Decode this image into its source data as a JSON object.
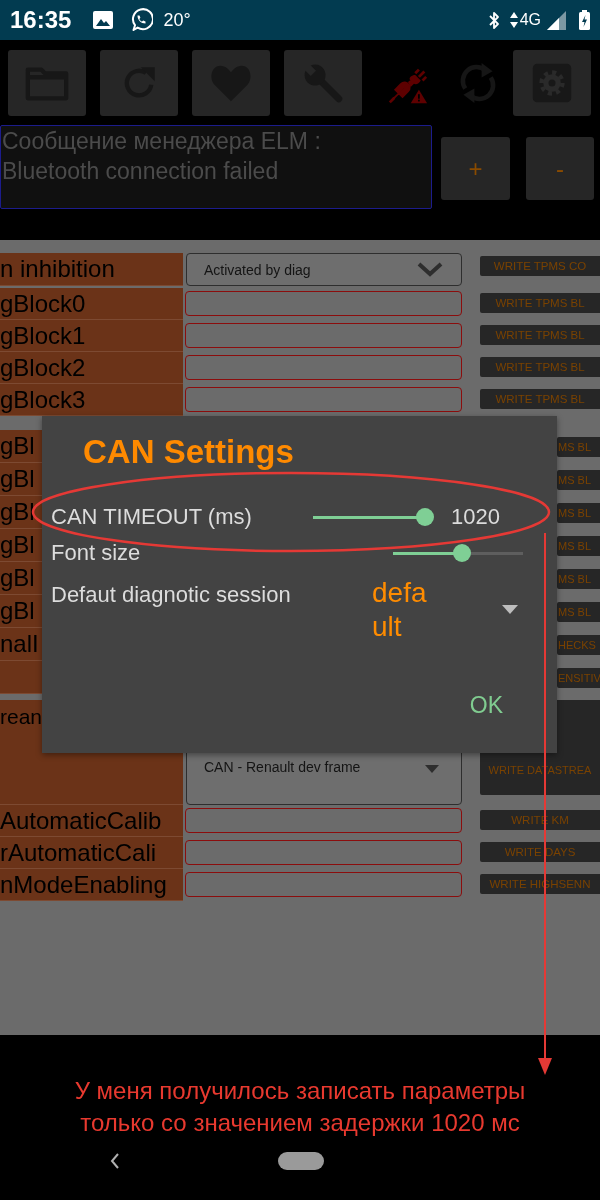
{
  "status_bar": {
    "time": "16:35",
    "temperature": "20°",
    "network": "4G"
  },
  "message": {
    "text": "Сообщение менеджера ELM :\nBluetooth connection failed"
  },
  "zoom_buttons": [
    "+",
    "-"
  ],
  "form": {
    "rows": [
      {
        "kind": "dropdown",
        "label": "n inhibition",
        "value": "Activated by diag",
        "button": "WRITE TPMS CO"
      },
      {
        "kind": "input",
        "label": "gBlock0",
        "button": "WRITE TPMS BL"
      },
      {
        "kind": "input",
        "label": "gBlock1",
        "button": "WRITE TPMS BL"
      },
      {
        "kind": "input",
        "label": "gBlock2",
        "button": "WRITE TPMS BL"
      },
      {
        "kind": "input",
        "label": "gBlock3",
        "button": "WRITE TPMS BL"
      },
      {
        "kind": "partial",
        "label": "gBl",
        "button": "MS BL"
      },
      {
        "kind": "partial",
        "label": "gBl",
        "button": "MS BL"
      },
      {
        "kind": "partial",
        "label": "gBl",
        "button": "MS BL"
      },
      {
        "kind": "partial",
        "label": "gBl",
        "button": "MS BL"
      },
      {
        "kind": "partial",
        "label": "gBl",
        "button": "MS BL"
      },
      {
        "kind": "partial",
        "label": "gBl",
        "button": "MS BL"
      },
      {
        "kind": "partial",
        "label": "nalI",
        "button": "HECKS"
      },
      {
        "kind": "partial",
        "button": "ENSITIV"
      },
      {
        "kind": "tall",
        "label": "rean",
        "value": "CAN - Renault dev frame",
        "button": "WRITE DATASTREA"
      },
      {
        "kind": "input",
        "label": "AutomaticCalib",
        "button": "WRITE KM"
      },
      {
        "kind": "input",
        "label": "rAutomaticCali",
        "button": "WRITE DAYS"
      },
      {
        "kind": "input",
        "label": "nModeEnabling",
        "button": "WRITE HIGHSENN"
      }
    ]
  },
  "dialog": {
    "title": "CAN Settings",
    "settings": [
      {
        "kind": "slider",
        "label": "CAN TIMEOUT (ms)",
        "level": 1,
        "reading": "1020"
      },
      {
        "kind": "slider",
        "label": "Font size",
        "level": 0.53
      },
      {
        "kind": "dropdown",
        "label": "Defaut diagnotic session",
        "value": "default"
      }
    ],
    "ok_button": "OK"
  },
  "annotation": {
    "caption": "У меня получилось записать параметры только со значением задержки 1020 мс"
  }
}
